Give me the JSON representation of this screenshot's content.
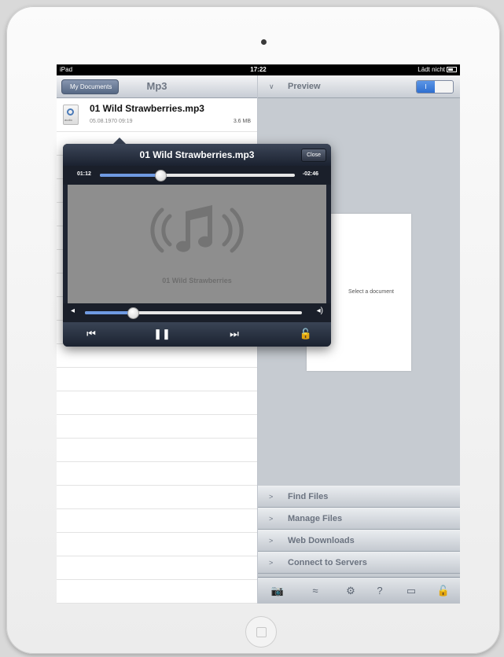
{
  "status_bar": {
    "carrier": "iPad",
    "time": "17:22",
    "charge_text": "Lädt nicht"
  },
  "left_pane": {
    "back_button": "My Documents",
    "title": "Mp3",
    "files": [
      {
        "name": "01 Wild Strawberries.mp3",
        "date": "05.08.1970 09:19",
        "size": "3.6 MB",
        "icon_tag": "audio"
      }
    ]
  },
  "right_pane": {
    "header": "Preview",
    "toggle_label": "I",
    "placeholder": "Select a document",
    "menu": [
      "Find Files",
      "Manage Files",
      "Web Downloads",
      "Connect to Servers"
    ],
    "toolbar_icons": [
      "camera-icon",
      "wifi-icon",
      "gear-icon",
      "help-icon",
      "display-icon",
      "lock-icon"
    ]
  },
  "player": {
    "title": "01 Wild Strawberries.mp3",
    "close_label": "Close",
    "elapsed": "01:12",
    "remaining": "-02:46",
    "progress_fraction": 0.31,
    "volume_fraction": 0.22,
    "track_name": "01 Wild Strawberries",
    "controls": [
      "previous-icon",
      "pause-icon",
      "next-icon",
      "lock-icon"
    ]
  },
  "colors": {
    "accent": "#2f6fd0",
    "player_bg": "#1e2431",
    "artwork_bg": "#8e8e8e"
  }
}
